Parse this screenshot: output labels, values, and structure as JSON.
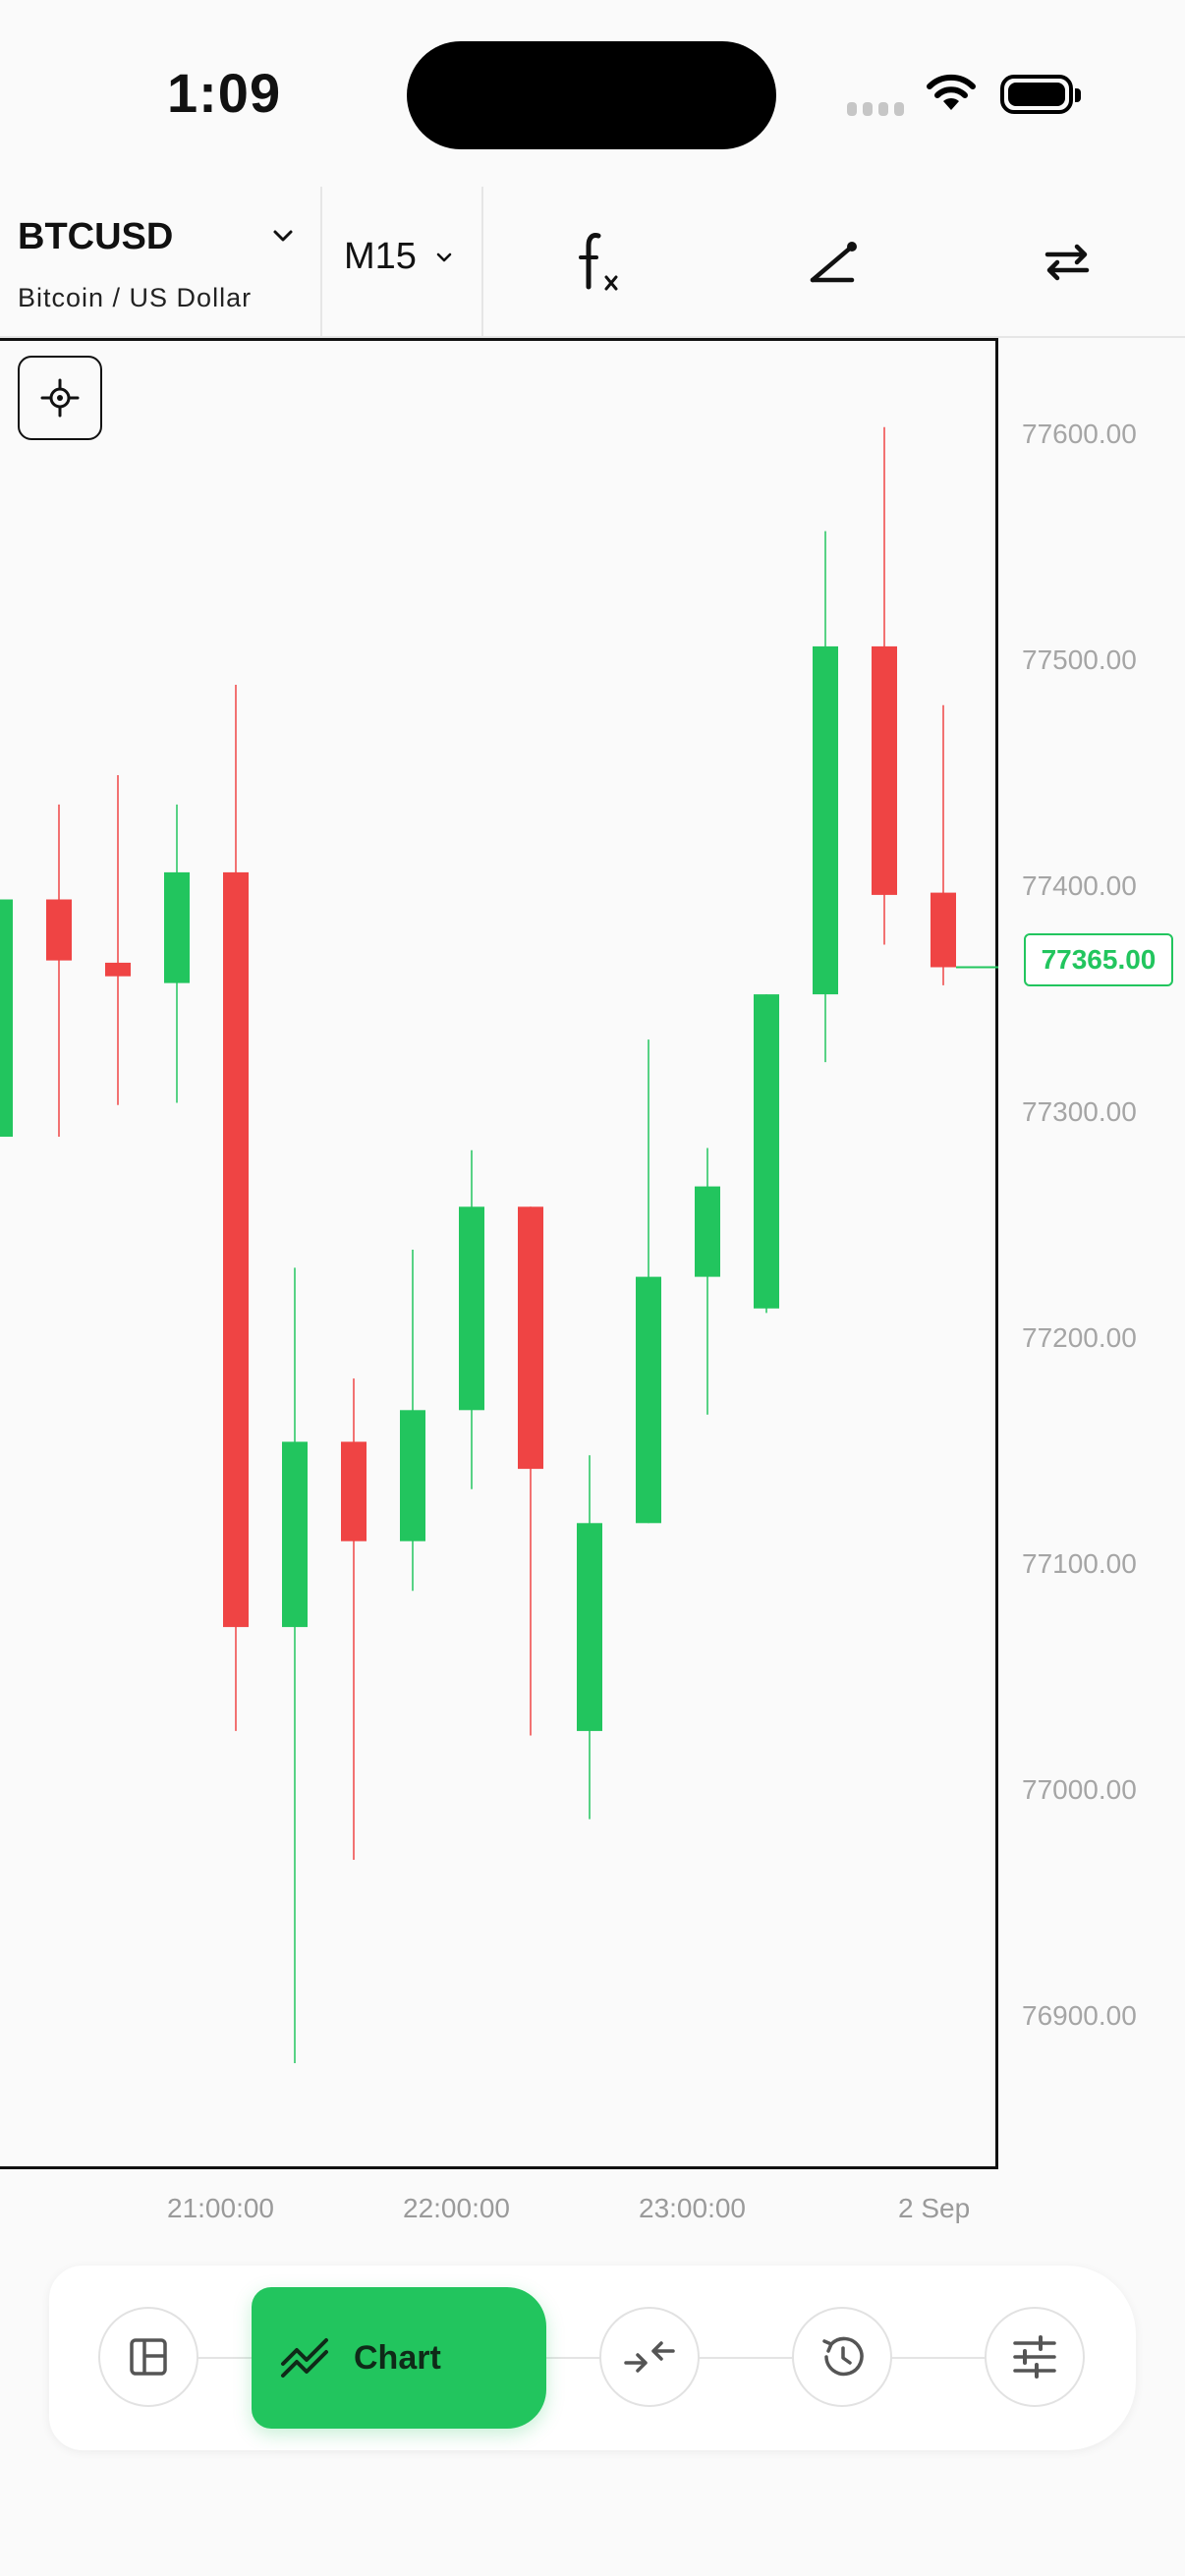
{
  "status_bar": {
    "time": "1:09"
  },
  "toolbar": {
    "symbol": "BTCUSD",
    "symbol_description": "Bitcoin / US Dollar",
    "timeframe": "M15"
  },
  "chart": {
    "y_axis_labels": [
      "77600.00",
      "77500.00",
      "77400.00",
      "77300.00",
      "77200.00",
      "77100.00",
      "77000.00",
      "76900.00"
    ],
    "x_axis_labels": [
      "21:00:00",
      "22:00:00",
      "23:00:00",
      "2 Sep"
    ],
    "current_price": "77365.00"
  },
  "colors": {
    "bull": "#22c55e",
    "bear": "#ef4444"
  },
  "chart_data": {
    "type": "candlestick",
    "ylim": [
      76850,
      77620
    ],
    "candles": [
      {
        "open": 77290,
        "high": 77395,
        "low": 77290,
        "close": 77395
      },
      {
        "open": 77395,
        "high": 77437,
        "low": 77290,
        "close": 77368
      },
      {
        "open": 77367,
        "high": 77450,
        "low": 77304,
        "close": 77361
      },
      {
        "open": 77358,
        "high": 77437,
        "low": 77305,
        "close": 77407
      },
      {
        "open": 77407,
        "high": 77490,
        "low": 77027,
        "close": 77073
      },
      {
        "open": 77073,
        "high": 77232,
        "low": 76880,
        "close": 77155
      },
      {
        "open": 77155,
        "high": 77183,
        "low": 76970,
        "close": 77111
      },
      {
        "open": 77111,
        "high": 77240,
        "low": 77089,
        "close": 77169
      },
      {
        "open": 77169,
        "high": 77284,
        "low": 77134,
        "close": 77259
      },
      {
        "open": 77259,
        "high": 77259,
        "low": 77025,
        "close": 77143
      },
      {
        "open": 77027,
        "high": 77149,
        "low": 76988,
        "close": 77119
      },
      {
        "open": 77119,
        "high": 77333,
        "low": 77119,
        "close": 77228
      },
      {
        "open": 77228,
        "high": 77285,
        "low": 77167,
        "close": 77268
      },
      {
        "open": 77214,
        "high": 77353,
        "low": 77212,
        "close": 77353
      },
      {
        "open": 77353,
        "high": 77558,
        "low": 77323,
        "close": 77507
      },
      {
        "open": 77507,
        "high": 77604,
        "low": 77375,
        "close": 77397
      },
      {
        "open": 77398,
        "high": 77481,
        "low": 77357,
        "close": 77365
      }
    ]
  },
  "bottom_nav": {
    "active_label": "Chart"
  }
}
